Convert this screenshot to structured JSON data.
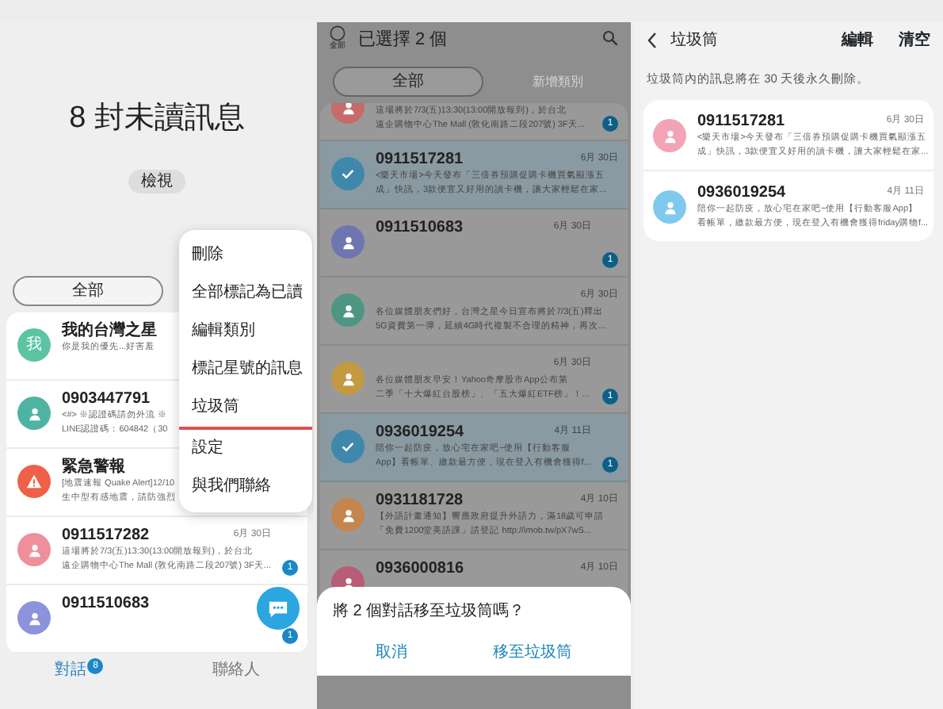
{
  "inbox": {
    "title": "8 封未讀訊息",
    "view_button": "檢視",
    "filter": "全部",
    "conversations": [
      {
        "name": "我的台灣之星",
        "avatar": {
          "kind": "letter",
          "text": "我"
        },
        "color": "#5cc3a3",
        "preview": [
          "你是我的優先...好害羞"
        ]
      },
      {
        "name": "0903447791",
        "avatar": {
          "kind": "person"
        },
        "color": "#4fb3a3",
        "preview": [
          "<#> ※認證碼請勿外流 ※",
          "LINE認證碼：604842（30"
        ]
      },
      {
        "name": "緊急警報",
        "avatar": {
          "kind": "alert"
        },
        "color": "#ee6148",
        "preview": [
          "[地震速報 Quake Alert]12/10",
          "生中型有感地震，請防強烈"
        ]
      },
      {
        "name": "0911517282",
        "avatar": {
          "kind": "person"
        },
        "color": "#ef8f9b",
        "date": "6月 30日",
        "preview": [
          "這場將於7/3(五)13:30(13:00開放報到)，於台北",
          "遠企購物中心The Mall (敦化南路二段207號) 3F天..."
        ],
        "unread": "1"
      },
      {
        "name": "0911510683",
        "avatar": {
          "kind": "person"
        },
        "color": "#8c92dc",
        "unread": "1"
      }
    ],
    "menu": [
      {
        "label": "刪除",
        "highlighted": false
      },
      {
        "label": "全部標記為已讀",
        "highlighted": false
      },
      {
        "label": "編輯類別",
        "highlighted": false
      },
      {
        "label": "標記星號的訊息",
        "highlighted": false
      },
      {
        "label": "垃圾筒",
        "highlighted": true
      },
      {
        "label": "設定",
        "highlighted": false
      },
      {
        "label": "與我們聯絡",
        "highlighted": false
      }
    ],
    "bottom_tabs": [
      {
        "label": "對話",
        "badge": "8",
        "selected": true
      },
      {
        "label": "聯絡人",
        "selected": false
      }
    ]
  },
  "selection": {
    "select_all_label": "全部",
    "select_all_checked": false,
    "title": "已選擇 2 個",
    "filters": [
      {
        "label": "全部",
        "enabled": true
      },
      {
        "label": "新增類別",
        "enabled": false
      }
    ],
    "conversations": [
      {
        "avatar": {
          "kind": "person"
        },
        "color": "#c66a6a",
        "preview": [
          "這場將於7/3(五)13:30(13:00開放報到)，於台北",
          "遠企購物中心The Mall (敦化南路二段207號) 3F天..."
        ],
        "unread": "1",
        "selected": false
      },
      {
        "name": "0911517281",
        "date": "6月 30日",
        "preview": [
          "<樂天市場>今天發布「三倍券預購促購卡機買氣顯漲五",
          "成」快訊，3款便宜又好用的讀卡機，讓大家輕鬆在家..."
        ],
        "selected": true
      },
      {
        "name": "0911510683",
        "avatar": {
          "kind": "person"
        },
        "color": "#6f75b0",
        "date": "6月 30日",
        "unread": "1",
        "selected": false
      },
      {
        "avatar": {
          "kind": "person"
        },
        "color": "#4e9683",
        "date": "6月 30日",
        "preview": [
          "各位媒體朋友們好，台灣之星今日宣布將於7/3(五)釋出",
          "5G資費第一彈，延續4G時代複製不合理的精神，再次..."
        ],
        "selected": false
      },
      {
        "avatar": {
          "kind": "person"
        },
        "color": "#c39a42",
        "date": "6月 30日",
        "preview": [
          "各位媒體朋友早安！Yahoo奇摩股市App公布第",
          "二季「十大爆紅台股榜」、「五大爆紅ETF榜」！..."
        ],
        "unread": "1",
        "selected": false
      },
      {
        "name": "0936019254",
        "date": "4月 11日",
        "preview": [
          "陪你一起防疫，放心宅在家吧~使用【行動客服",
          "App】看帳單、繳款最方便，現在登入有機會獲得f..."
        ],
        "unread": "1",
        "selected": true
      },
      {
        "name": "0931181728",
        "avatar": {
          "kind": "person"
        },
        "color": "#c4854e",
        "date": "4月 10日",
        "preview": [
          "【外語計畫通知】響應政府提升外語力，滿18歲可申請",
          "「免費1200堂美語課」請登記 http://imob.tw/pX7wS..."
        ],
        "selected": false
      },
      {
        "name": "0936000816",
        "avatar": {
          "kind": "person"
        },
        "color": "#b85c78",
        "date": "4月 10日",
        "selected": false
      }
    ],
    "dialog": {
      "message": "將 2 個對話移至垃圾筒嗎？",
      "buttons": [
        "取消",
        "移至垃圾筒"
      ]
    }
  },
  "trash": {
    "title": "垃圾筒",
    "actions": [
      "編輯",
      "清空"
    ],
    "notice": "垃圾筒內的訊息將在 30 天後永久刪除。",
    "conversations": [
      {
        "name": "0911517281",
        "avatar": {
          "kind": "person"
        },
        "color": "#f3a3b6",
        "date": "6月 30日",
        "preview": [
          "<樂天市場>今天發布「三倍券預購促購卡機買氣顯漲五",
          "成」快訊，3款便宜又好用的讀卡機，讓大家輕鬆在家..."
        ]
      },
      {
        "name": "0936019254",
        "avatar": {
          "kind": "person"
        },
        "color": "#80c9ee",
        "date": "4月 11日",
        "preview": [
          "陪你一起防疫，放心宅在家吧~使用【行動客服App】",
          "看帳單，繳款最方便，現在登入有機會獲得friday購物f..."
        ]
      }
    ]
  }
}
